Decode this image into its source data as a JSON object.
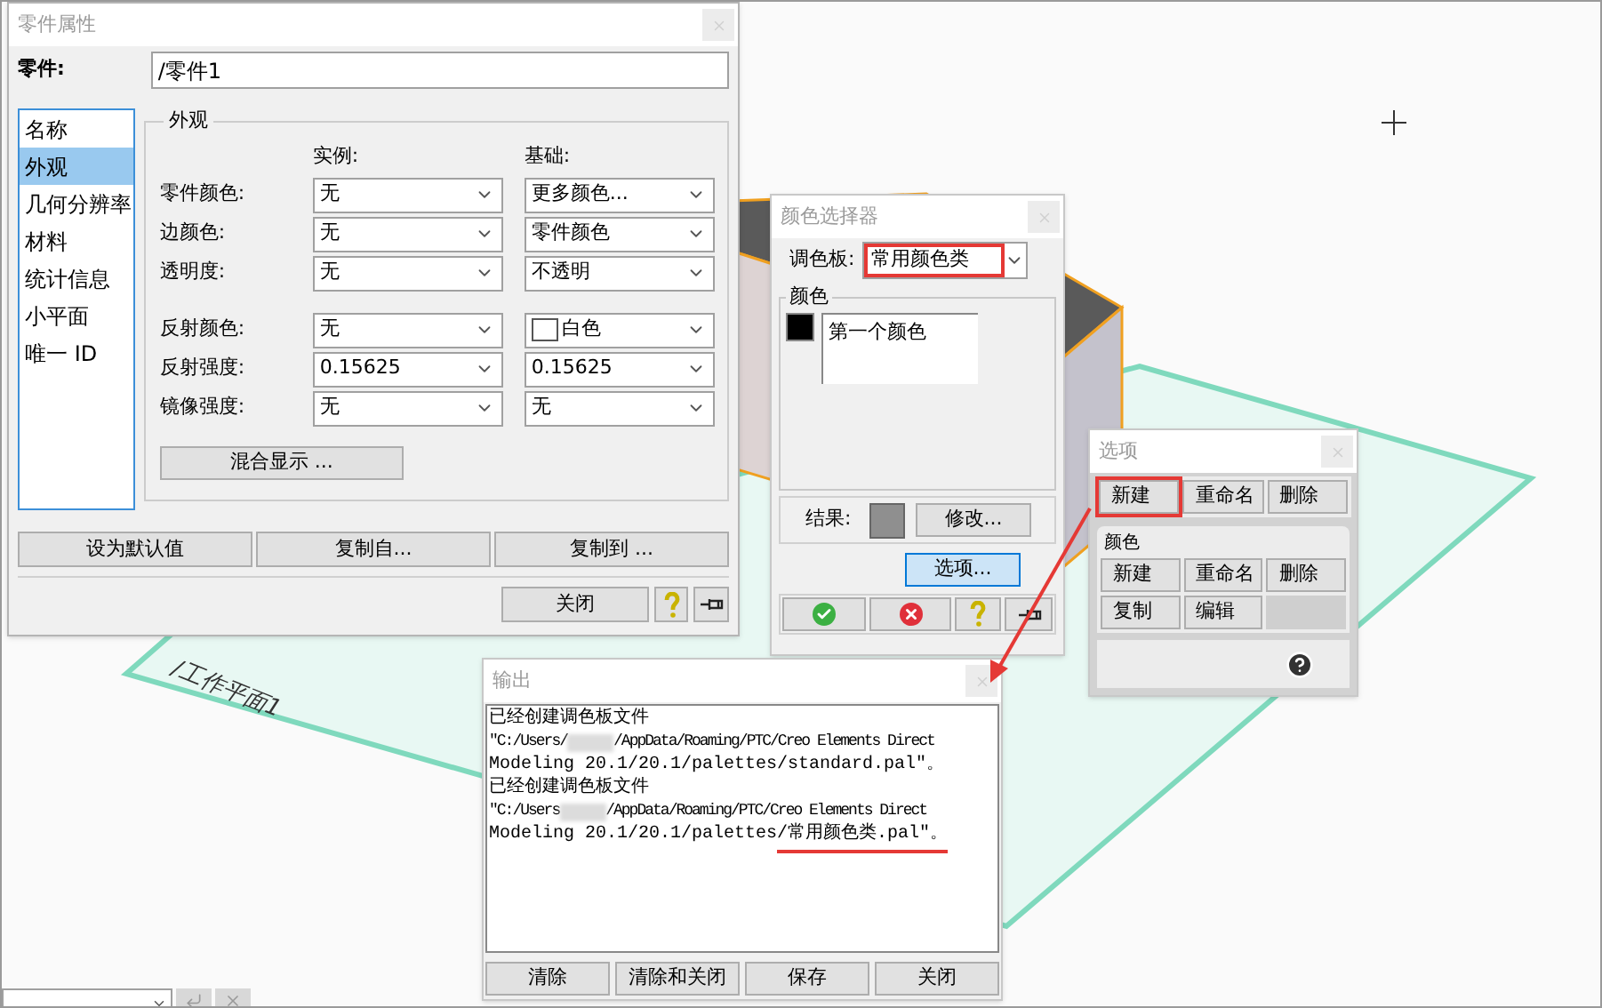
{
  "scene": {
    "plane_label": "/工作平面1"
  },
  "part_properties": {
    "title": "零件属性",
    "part_label": "零件:",
    "part_value": "/零件1",
    "nav": [
      {
        "label": "名称",
        "selected": false
      },
      {
        "label": "外观",
        "selected": true
      },
      {
        "label": "几何分辨率",
        "selected": false
      },
      {
        "label": "材料",
        "selected": false
      },
      {
        "label": "统计信息",
        "selected": false
      },
      {
        "label": "小平面",
        "selected": false
      },
      {
        "label": "唯一 ID",
        "selected": false
      }
    ],
    "group_title": "外观",
    "column_headers": [
      "实例:",
      "基础:"
    ],
    "color_rows": [
      {
        "label": "零件颜色:",
        "instance": "无",
        "base": "更多颜色...",
        "base_swatch": false
      },
      {
        "label": "边颜色:",
        "instance": "无",
        "base": "零件颜色",
        "base_swatch": false
      },
      {
        "label": "透明度:",
        "instance": "无",
        "base": "不透明",
        "base_swatch": false
      }
    ],
    "reflection_rows": [
      {
        "label": "反射颜色:",
        "instance": "无",
        "base": "白色",
        "base_swatch": true
      },
      {
        "label": "反射强度:",
        "instance": "0.15625",
        "base": "0.15625",
        "base_swatch": false
      },
      {
        "label": "镜像强度:",
        "instance": "无",
        "base": "无",
        "base_swatch": false
      }
    ],
    "blend_button": "混合显示 ...",
    "actions": [
      "设为默认值",
      "复制自...",
      "复制到 ..."
    ],
    "close_button": "关闭"
  },
  "color_picker": {
    "title": "颜色选择器",
    "palette_label": "调色板:",
    "palette_value": "常用颜色类",
    "palette_annotated": true,
    "group_title": "颜色",
    "colors": [
      {
        "name": "第一个颜色",
        "color": "#000000"
      }
    ],
    "result_label": "结果:",
    "modify_button": "修改...",
    "options_button": {
      "label": "选项...",
      "selected": true
    }
  },
  "options": {
    "title": "选项",
    "palette_buttons": [
      {
        "label": "新建",
        "annotated": true
      },
      {
        "label": "重命名",
        "annotated": false
      },
      {
        "label": "删除",
        "annotated": false
      }
    ],
    "group_title": "颜色",
    "color_buttons": [
      {
        "label": "新建",
        "disabled": false
      },
      {
        "label": "重命名",
        "disabled": false
      },
      {
        "label": "删除",
        "disabled": false
      },
      {
        "label": "复制",
        "disabled": false
      },
      {
        "label": "编辑",
        "disabled": false
      },
      {
        "disabled": true
      }
    ]
  },
  "output": {
    "title": "输出",
    "lines": [
      {
        "kind": "text",
        "text": "已经创建调色板文件"
      },
      {
        "kind": "path",
        "before": "\"C:/Users/",
        "after": "/AppData/Roaming/PTC/Creo Elements Direct"
      },
      {
        "kind": "text",
        "text": "Modeling 20.1/20.1/palettes/standard.pal\"。"
      },
      {
        "kind": "text",
        "text": "已经创建调色板文件"
      },
      {
        "kind": "path",
        "before": "\"C:/Users",
        "after": "/AppData/Roaming/PTC/Creo Elements Direct"
      },
      {
        "kind": "marked",
        "text": "Modeling 20.1/20.1/palettes",
        "marked": "/常用颜色类.pal\"。"
      }
    ],
    "buttons": [
      "清除",
      "清除和关闭",
      "保存",
      "关闭"
    ]
  }
}
